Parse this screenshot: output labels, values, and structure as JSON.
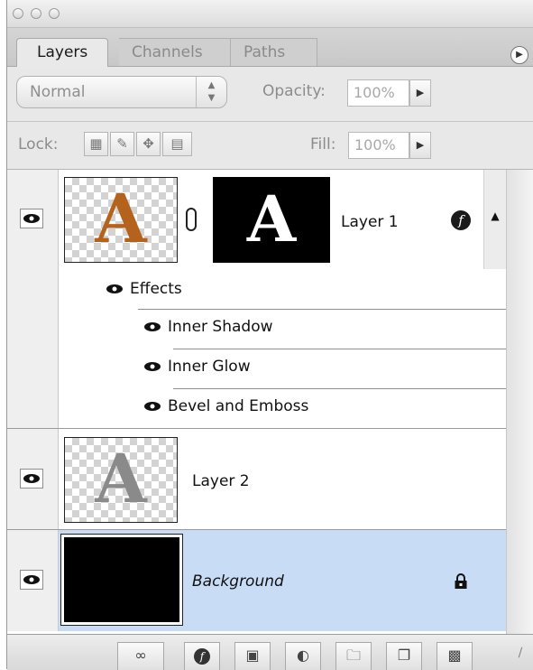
{
  "tabs": [
    "Layers",
    "Channels",
    "Paths"
  ],
  "blend_mode": "Normal",
  "opacity": {
    "label": "Opacity:",
    "value": "100%"
  },
  "lock": {
    "label": "Lock:"
  },
  "fill": {
    "label": "Fill:",
    "value": "100%"
  },
  "layers": [
    {
      "name": "Layer 1",
      "thumb_letter": "A",
      "mask_letter": "A"
    },
    {
      "name": "Layer 2",
      "thumb_letter": "A"
    },
    {
      "name": "Background"
    }
  ],
  "effects": {
    "label": "Effects",
    "items": [
      "Inner Shadow",
      "Inner Glow",
      "Bevel and Emboss"
    ]
  },
  "colors": {
    "selected_row": "#c9dcf6",
    "layer1_thumb": "#b4621c",
    "layer2_thumb": "#8a8a8a"
  },
  "icons": {
    "fx": "fx-icon",
    "lock": "lock-icon",
    "eye": "eye-icon",
    "link": "link-icon",
    "trash": "trash-icon"
  }
}
